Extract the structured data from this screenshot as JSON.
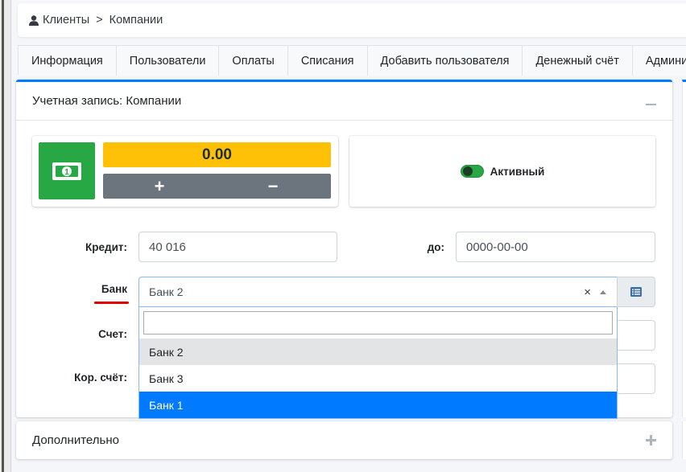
{
  "breadcrumb": {
    "icon": "user-icon",
    "items": [
      "Клиенты",
      "Компании"
    ],
    "separator": ">"
  },
  "tabs": [
    "Информация",
    "Пользователи",
    "Оплаты",
    "Списания",
    "Добавить пользователя",
    "Денежный счёт",
    "Администр"
  ],
  "card": {
    "title": "Учетная запись: Компании",
    "balance": {
      "amount": "0.00",
      "plus": "+",
      "minus": "−",
      "icon": "money-bill-icon"
    },
    "status": {
      "label": "Активный",
      "enabled": true
    },
    "form": {
      "credit_label": "Кредит:",
      "credit_value": "40 016",
      "until_label": "до:",
      "until_value": "0000-00-00",
      "bank_label": "Банк",
      "bank_value": "Банк 2",
      "bank_clear": "×",
      "account_label": "Счет:",
      "corr_label": "Кор. счёт:"
    },
    "dropdown": {
      "search_value": "",
      "options": [
        "Банк 2",
        "Банк 3",
        "Банк 1"
      ],
      "hovered": "Банк 2",
      "highlighted": "Банк 1"
    }
  },
  "card2": {
    "title": "Дополнительно"
  },
  "colors": {
    "accent": "#007bff",
    "success": "#28a745",
    "warning": "#ffc107",
    "secondary": "#6c757d",
    "marker": "#e00000"
  }
}
